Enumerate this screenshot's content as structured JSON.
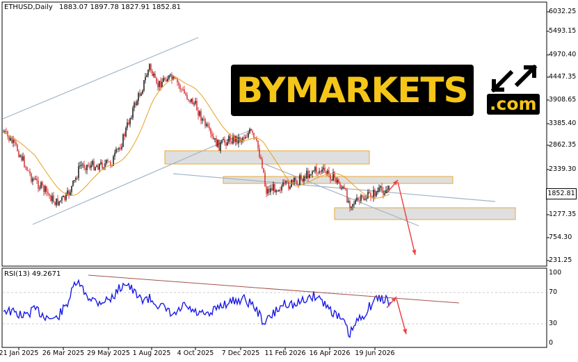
{
  "header": {
    "symbol": "ETHUSD,Daily",
    "ohlc": "1883.07 1897.78 1827.91 1852.81"
  },
  "rsi": {
    "label": "RSI(13) 49.2671",
    "levels": [
      "100",
      "70",
      "30",
      "0"
    ]
  },
  "current_price": "1852.81",
  "watermark": {
    "main": "BYMARKETS",
    "sub": ".com"
  },
  "chart_data": {
    "type": "line",
    "y_ticks": [
      "6032.25",
      "5493.15",
      "4970.40",
      "4447.35",
      "3908.65",
      "3385.40",
      "2862.35",
      "2339.30",
      "1277.35",
      "754.30",
      "231.25"
    ],
    "x_ticks": [
      "21 Jan 2025",
      "26 Mar 2025",
      "29 May 2025",
      "1 Aug 2025",
      "4 Oct 2025",
      "7 Dec 2025",
      "11 Feb 2026",
      "16 Apr 2026",
      "19 Jun 2026"
    ],
    "ylim": [
      231.25,
      6032.25
    ],
    "colors": {
      "bull": "#000000",
      "bear": "#d21e1e",
      "ma_fast": "#e6a020",
      "ma_slow": "#2aa79b",
      "rsi": "#1a1ae6",
      "channel": "#9fb3c8",
      "zone_fill": "#dcdcdc",
      "zone_border": "#e6a020",
      "arrow": "#ef4444",
      "rsi_trend": "#a0524a"
    }
  }
}
